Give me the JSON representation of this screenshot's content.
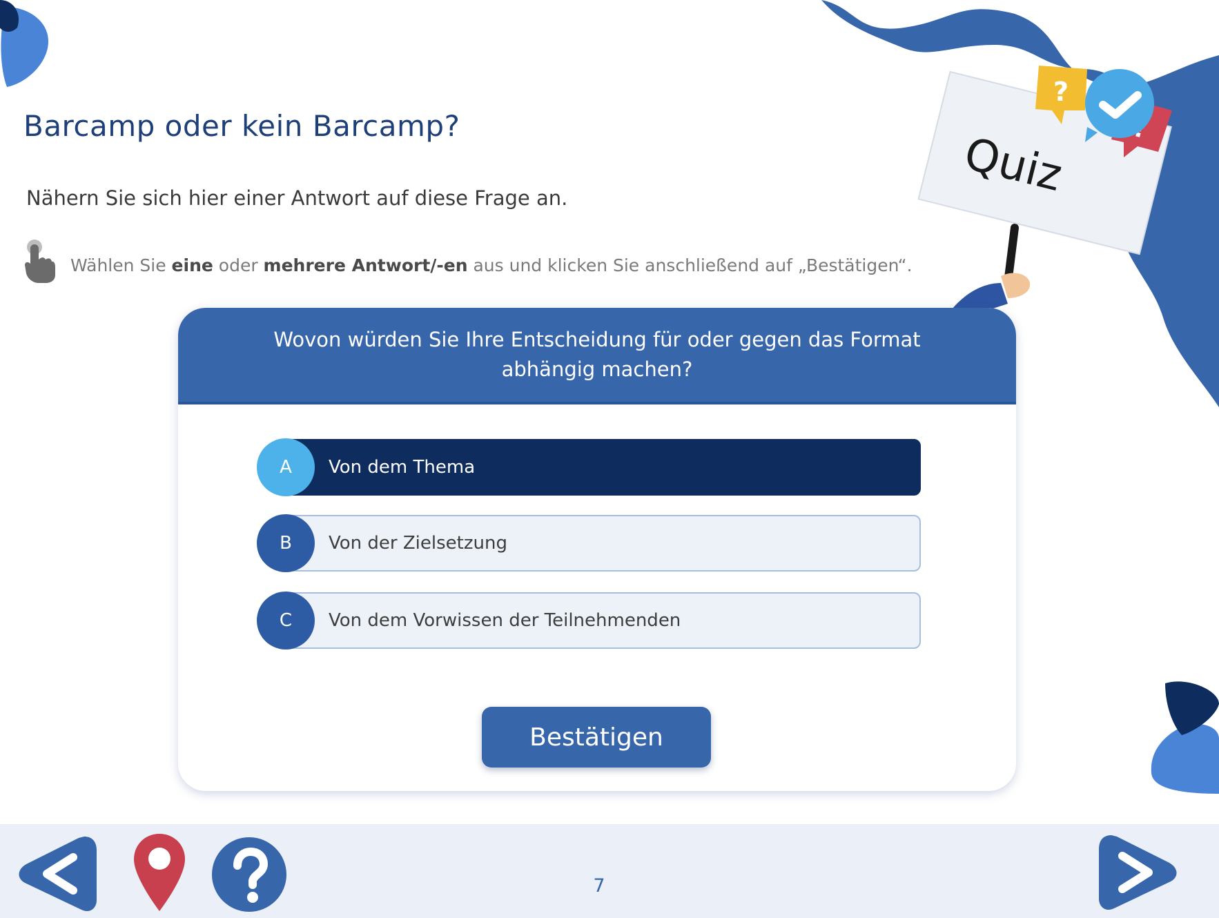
{
  "title": "Barcamp oder kein Barcamp?",
  "intro": "Nähern Sie sich hier einer Antwort auf diese Frage an.",
  "hint": {
    "part1": "Wählen Sie ",
    "bold1": "eine",
    "part2": " oder ",
    "bold2": "mehrere Antwort/-en",
    "part3": " aus und klicken Sie anschließend auf „Bestätigen“."
  },
  "quiz_sign": "Quiz",
  "question": "Wovon würden Sie Ihre Entscheidung für oder gegen das Format abhängig machen?",
  "options": [
    {
      "letter": "A",
      "text": "Von dem Thema",
      "selected": true
    },
    {
      "letter": "B",
      "text": "Von der Zielsetzung",
      "selected": false
    },
    {
      "letter": "C",
      "text": "Von dem Vorwissen der Teilnehmenden",
      "selected": false
    }
  ],
  "confirm_label": "Bestätigen",
  "footer": {
    "page_number": "7",
    "icons": [
      "back-arrow-icon",
      "map-pin-icon",
      "help-icon",
      "next-arrow-icon"
    ]
  },
  "colors": {
    "primary": "#3766ab",
    "selected": "#0f2c5e",
    "badge_selected": "#4db2ea",
    "pin": "#c8404e"
  }
}
